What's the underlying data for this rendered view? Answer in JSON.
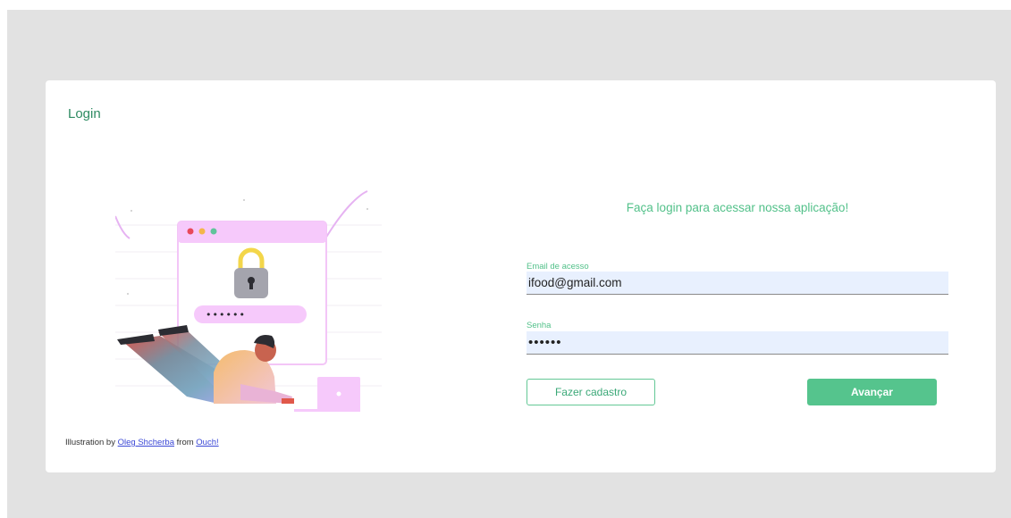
{
  "card": {
    "title": "Login"
  },
  "illustration": {
    "credit_prefix": "Illustration by ",
    "credit_author": "Oleg Shcherba",
    "credit_middle": " from ",
    "credit_source": "Ouch!",
    "password_mask": "••••••"
  },
  "form": {
    "heading": "Faça login para acessar nossa aplicação!",
    "email_label": "Email de acesso",
    "email_value": "ifood@gmail.com",
    "password_label": "Senha",
    "password_value": "••••••",
    "signup_label": "Fazer cadastro",
    "submit_label": "Avançar"
  },
  "colors": {
    "backdrop": "#e2e2e2",
    "accent_green": "#55c48d",
    "title_green": "#2e8b62",
    "input_bg": "#e8f0fe",
    "link": "#3b48d6"
  },
  "icons": [
    "lock-icon",
    "window-dots-icon",
    "laptop-icon"
  ]
}
